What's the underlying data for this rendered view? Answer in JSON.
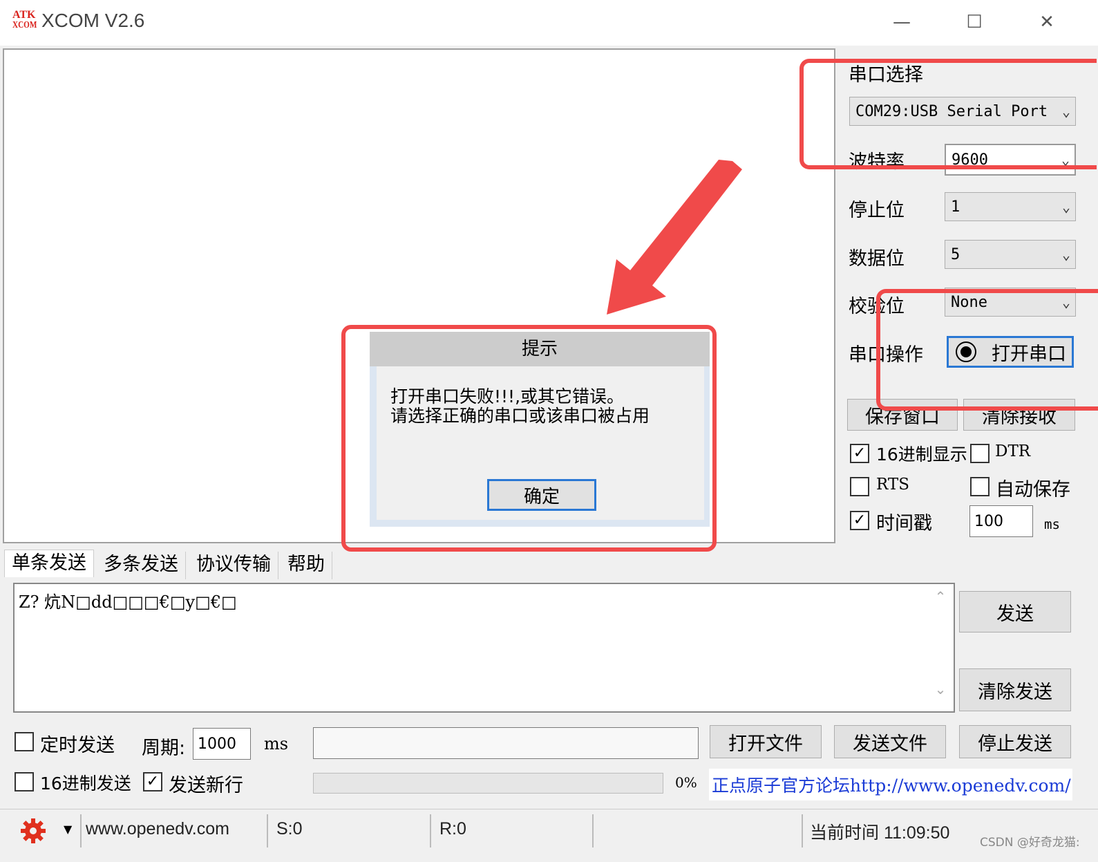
{
  "window": {
    "logo_top": "ATK",
    "logo_bottom": "XCOM",
    "title": "XCOM V2.6",
    "minimize": "—",
    "maximize": "☐",
    "close": "✕"
  },
  "serial": {
    "port_label": "串口选择",
    "port_value": "COM29:USB Serial Port",
    "baud_label": "波特率",
    "baud_value": "9600",
    "stop_label": "停止位",
    "stop_value": "1",
    "data_label": "数据位",
    "data_value": "5",
    "parity_label": "校验位",
    "parity_value": "None",
    "op_label": "串口操作",
    "open_button": "打开串口"
  },
  "receive": {
    "save_button": "保存窗口",
    "clear_button": "清除接收",
    "hex_display": "16进制显示",
    "hex_display_checked": true,
    "dtr": "DTR",
    "dtr_checked": false,
    "rts": "RTS",
    "rts_checked": false,
    "auto_save": "自动保存",
    "auto_save_checked": false,
    "timestamp": "时间戳",
    "timestamp_checked": true,
    "timestamp_value": "100",
    "timestamp_unit": "ms"
  },
  "dialog": {
    "title": "提示",
    "line1": "打开串口失败!!!,或其它错误。",
    "line2": "请选择正确的串口或该串口被占用",
    "ok": "确定"
  },
  "tabs": [
    "单条发送",
    "多条发送",
    "协议传输",
    "帮助"
  ],
  "send": {
    "text": "Z? 炕N□dd□□□€□y□€□",
    "send_button": "发送",
    "clear_button": "清除发送",
    "timed_send": "定时发送",
    "timed_send_checked": false,
    "period_label": "周期:",
    "period_value": "1000",
    "period_unit": "ms",
    "open_file": "打开文件",
    "send_file": "发送文件",
    "stop_send": "停止发送",
    "hex_send": "16进制发送",
    "hex_send_checked": false,
    "newline": "发送新行",
    "newline_checked": true,
    "progress_text": "0%",
    "progress_value": 0,
    "forum_link": "正点原子官方论坛http://www.openedv.com/"
  },
  "status": {
    "url": "www.openedv.com",
    "sent": "S:0",
    "received": "R:0",
    "time": "当前时间 11:09:50"
  },
  "watermark": "CSDN @好奇龙猫:",
  "colors": {
    "annotation_red": "#f04a4a",
    "focus_blue": "#2a78d4",
    "link_blue": "#1a3bd6",
    "gear_red": "#e0301e"
  }
}
